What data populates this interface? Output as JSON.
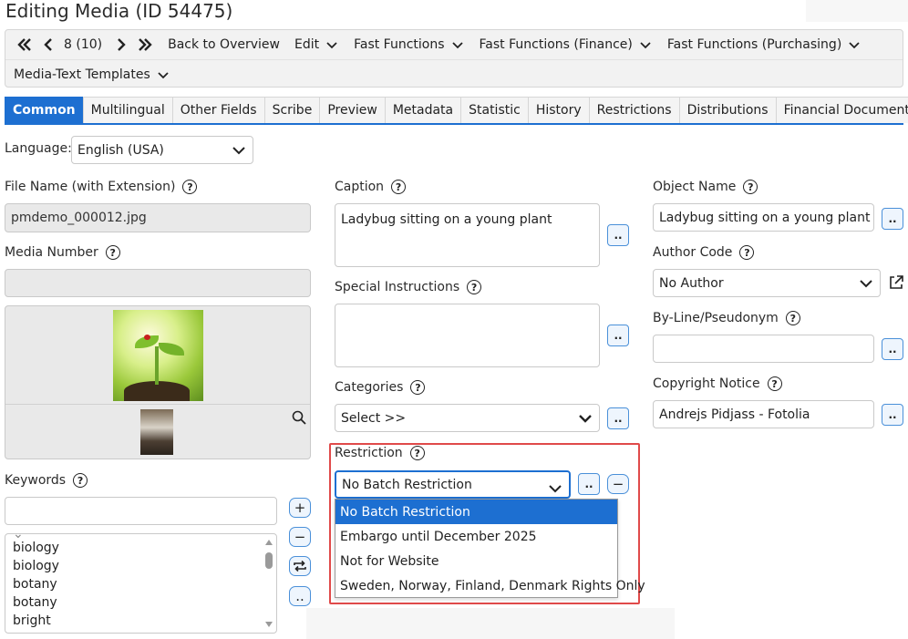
{
  "page": {
    "title": "Editing Media (ID 54475)"
  },
  "toolbar": {
    "position": "8 (10)",
    "back": "Back to Overview",
    "edit": "Edit",
    "fast_functions": "Fast Functions",
    "fast_finance": "Fast Functions (Finance)",
    "fast_purchasing": "Fast Functions (Purchasing)",
    "templates": "Media-Text Templates"
  },
  "tabs": [
    "Common",
    "Multilingual",
    "Other Fields",
    "Scribe",
    "Preview",
    "Metadata",
    "Statistic",
    "History",
    "Restrictions",
    "Distributions",
    "Financial Documents"
  ],
  "language": {
    "label": "Language:",
    "value": "English (USA)"
  },
  "left": {
    "file_name_label": "File Name (with Extension)",
    "file_name": "pmdemo_000012.jpg",
    "media_number_label": "Media Number",
    "media_number": "",
    "keywords_label": "Keywords",
    "keyword_input": "",
    "keywords": [
      "biology",
      "biology",
      "botany",
      "botany",
      "bright"
    ]
  },
  "middle": {
    "caption_label": "Caption",
    "caption": "Ladybug sitting on a young plant",
    "special_label": "Special Instructions",
    "special": "",
    "categories_label": "Categories",
    "categories_value": "Select >>",
    "restriction_label": "Restriction",
    "restriction_value": "No Batch Restriction",
    "restriction_options": [
      "No Batch Restriction",
      "Embargo until December 2025",
      "Not for Website",
      "Sweden, Norway, Finland, Denmark Rights Only"
    ]
  },
  "right": {
    "object_name_label": "Object Name",
    "object_name": "Ladybug sitting on a young plant",
    "author_code_label": "Author Code",
    "author_code": "No Author",
    "byline_label": "By-Line/Pseudonym",
    "byline": "",
    "copyright_label": "Copyright Notice",
    "copyright": "Andrejs Pidjass - Fotolia"
  },
  "icons": {
    "help": "?",
    "dots": "..",
    "plus": "+",
    "minus": "−",
    "repeat": "⇄",
    "tab_prev": "❮",
    "tab_next": "❯"
  }
}
